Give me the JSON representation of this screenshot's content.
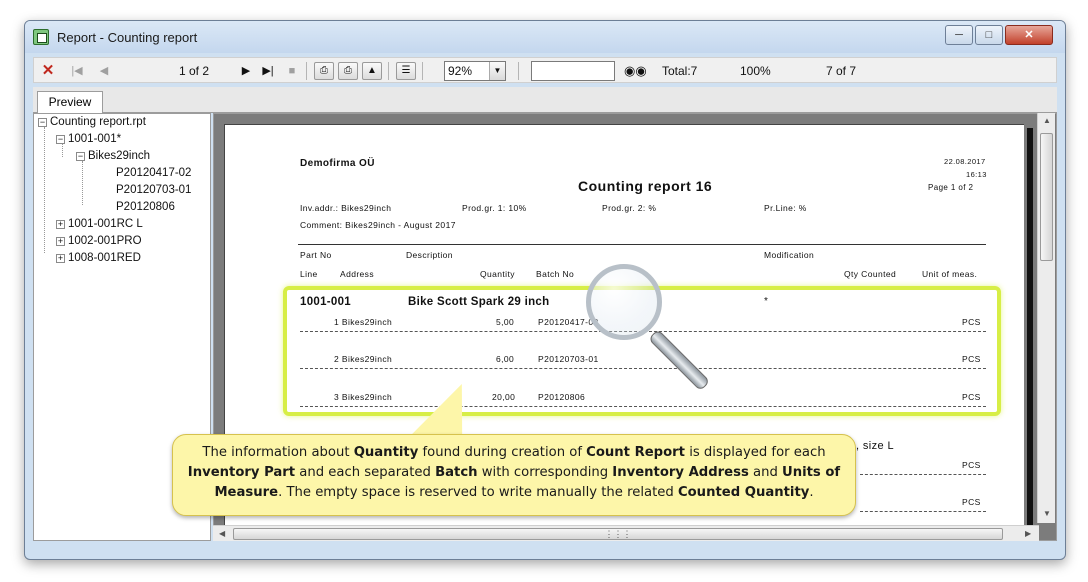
{
  "window": {
    "title": "Report - Counting report"
  },
  "toolbar": {
    "page_indicator": "1 of 2",
    "zoom": "92%",
    "total": "Total:7",
    "percent": "100%",
    "count": "7 of 7",
    "icons": [
      "close-icon",
      "first-page-icon",
      "prev-page-icon",
      "next-page-icon",
      "last-page-icon",
      "stop-icon",
      "print-icon",
      "print-setup-icon",
      "export-icon",
      "tree-toggle-icon",
      "binoculars-icon"
    ]
  },
  "tabs": {
    "preview": "Preview"
  },
  "tree": {
    "root": "Counting report.rpt",
    "n1": "1001-001*",
    "n1_child": "Bikes29inch",
    "batches": [
      "P20120417-02",
      "P20120703-01",
      "P20120806"
    ],
    "others": [
      "1001-001RC L",
      "1002-001PRO",
      "1008-001RED"
    ]
  },
  "report": {
    "company": "Demofirma OÜ",
    "title": "Counting report  16",
    "date": "22.08.2017",
    "time": "16:13",
    "page": "Page 1 of 2",
    "inv_addr": "Inv.addr.: Bikes29inch",
    "prod_gr1": "Prod.gr. 1: 10%",
    "prod_gr2": "Prod.gr. 2: %",
    "pr_line": "Pr.Line: %",
    "comment": "Comment: Bikes29inch - August 2017",
    "col_part_no": "Part No",
    "col_description": "Description",
    "col_modification": "Modification",
    "col_line": "Line",
    "col_address": "Address",
    "col_quantity": "Quantity",
    "col_batch": "Batch No",
    "col_qty_counted": "Qty Counted",
    "col_unit": "Unit of meas.",
    "part_no": "1001-001",
    "part_desc": "Bike Scott Spark 29 inch",
    "part_mod": "*",
    "rows": [
      {
        "line": "1 Bikes29inch",
        "qty": "5,00",
        "batch": "P20120417-02",
        "unit": "PCS"
      },
      {
        "line": "2 Bikes29inch",
        "qty": "6,00",
        "batch": "P20120703-01",
        "unit": "PCS"
      },
      {
        "line": "3 Bikes29inch",
        "qty": "20,00",
        "batch": "P20120806",
        "unit": "PCS"
      }
    ],
    "next_part_fragment": ", size L",
    "lower_units": [
      "PCS",
      "PCS"
    ]
  },
  "callout": {
    "t1": "The information about ",
    "b1": "Quantity",
    "t2": " found during creation of ",
    "b2": "Count Report",
    "t3": " is displayed for each ",
    "b3": "Inventory Part",
    "t4": " and each separated ",
    "b4": "Batch",
    "t5": " with corresponding ",
    "b5": "Inventory Address",
    "t6": " and ",
    "b6": "Units of Measure",
    "t7": ".  The empty space is reserved to write manually the related ",
    "b7": "Counted Quantity",
    "t8": "."
  },
  "colors": {
    "highlight": "#d7ee46",
    "callout_bg": "#fdf6a9",
    "close_red": "#c0281e"
  }
}
